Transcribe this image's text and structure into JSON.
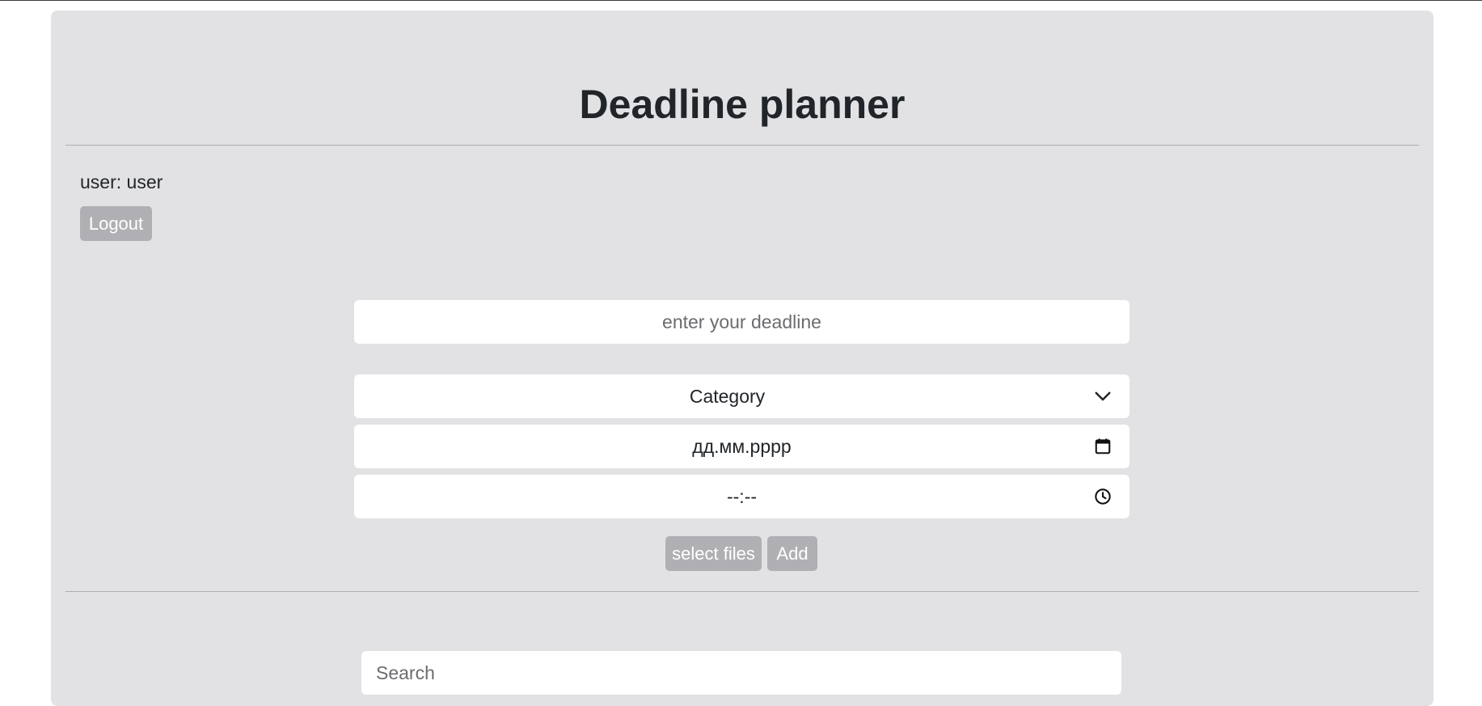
{
  "app": {
    "title": "Deadline planner"
  },
  "user": {
    "label": "user: user"
  },
  "buttons": {
    "logout": "Logout",
    "select_files": "select files",
    "add": "Add"
  },
  "form": {
    "deadline_placeholder": "enter your deadline",
    "category_selected": "Category",
    "date_placeholder": "дд.мм.рррр",
    "time_placeholder": "--:--"
  },
  "search": {
    "placeholder": "Search"
  },
  "icons": {
    "category": "chevron-down-icon",
    "date": "calendar-icon",
    "time": "clock-icon"
  },
  "colors": {
    "card_background": "#e2e2e5",
    "button_background": "#b0b0b4",
    "field_background": "#ffffff",
    "text": "#212529"
  }
}
